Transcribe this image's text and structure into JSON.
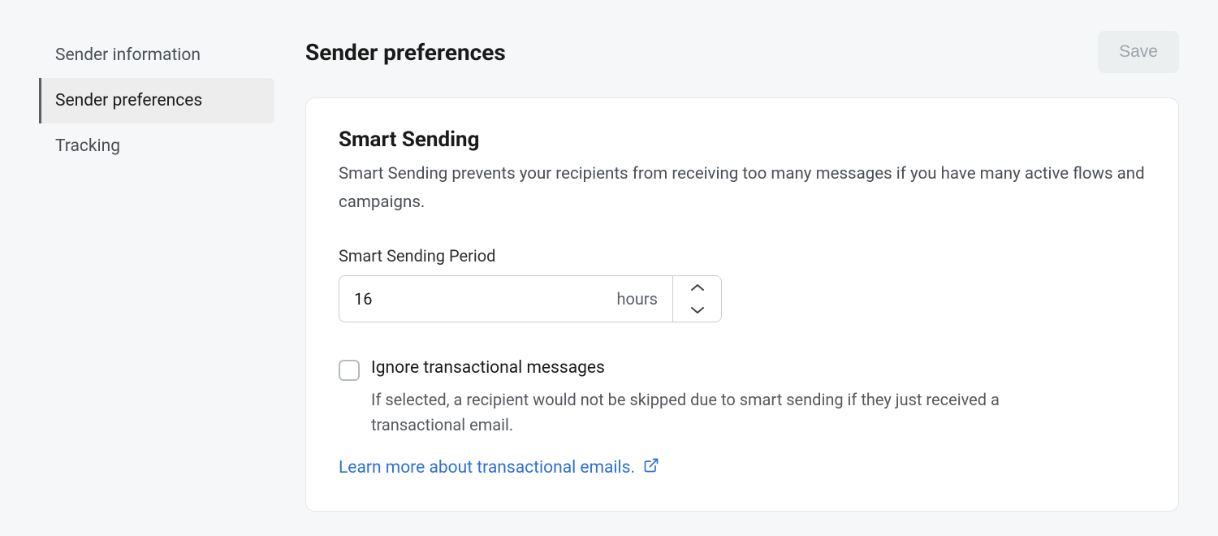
{
  "sidebar": {
    "items": [
      {
        "label": "Sender information",
        "active": false
      },
      {
        "label": "Sender preferences",
        "active": true
      },
      {
        "label": "Tracking",
        "active": false
      }
    ]
  },
  "header": {
    "title": "Sender preferences",
    "save_label": "Save"
  },
  "card": {
    "title": "Smart Sending",
    "description": "Smart Sending prevents your recipients from receiving too many messages if you have many active flows and campaigns.",
    "period_label": "Smart Sending Period",
    "period_value": "16",
    "period_unit": "hours",
    "ignore_label": "Ignore transactional messages",
    "ignore_checked": false,
    "ignore_help": "If selected, a recipient would not be skipped due to smart sending if they just received a transactional email.",
    "link_text": "Learn more about transactional emails."
  }
}
